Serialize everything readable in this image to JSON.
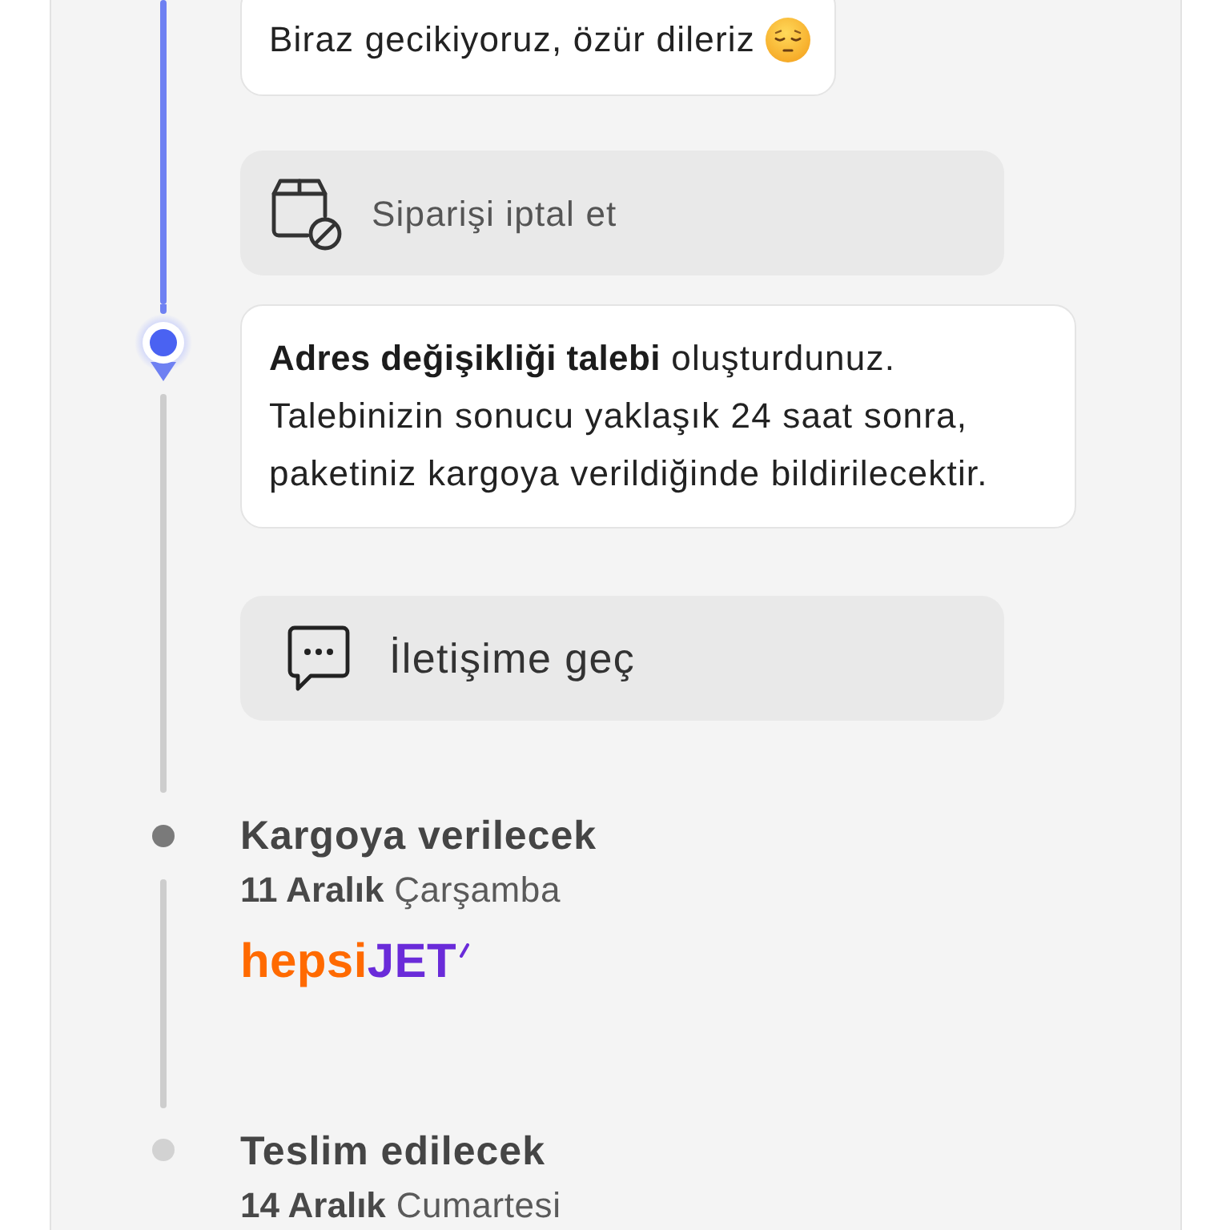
{
  "steps": [
    {
      "kind": "done",
      "items": [
        {
          "kind": "apology",
          "text": "Biraz gecikiyoruz, özür dileriz"
        },
        {
          "kind": "cancel",
          "label": "Siparişi iptal et"
        }
      ]
    },
    {
      "kind": "current",
      "items": [
        {
          "kind": "notice",
          "text": "**Adres değişikliği talebi** oluşturdunuz. Talebinizin sonucu yaklaşık 24 saat sonra, paketiniz kargoya verildiğinde bildirilecektir."
        },
        {
          "kind": "contact",
          "label": "İletişime geç"
        }
      ]
    },
    {
      "kind": "next",
      "title": "Kargoya verilecek",
      "date": "**11 Aralık** Çarşamba",
      "carrier_logo": {
        "prefix": "hepsi",
        "suffix": "JET"
      }
    },
    {
      "kind": "pending",
      "title": "Teslim edilecek",
      "date": "**14 Aralık** Cumartesi"
    }
  ]
}
